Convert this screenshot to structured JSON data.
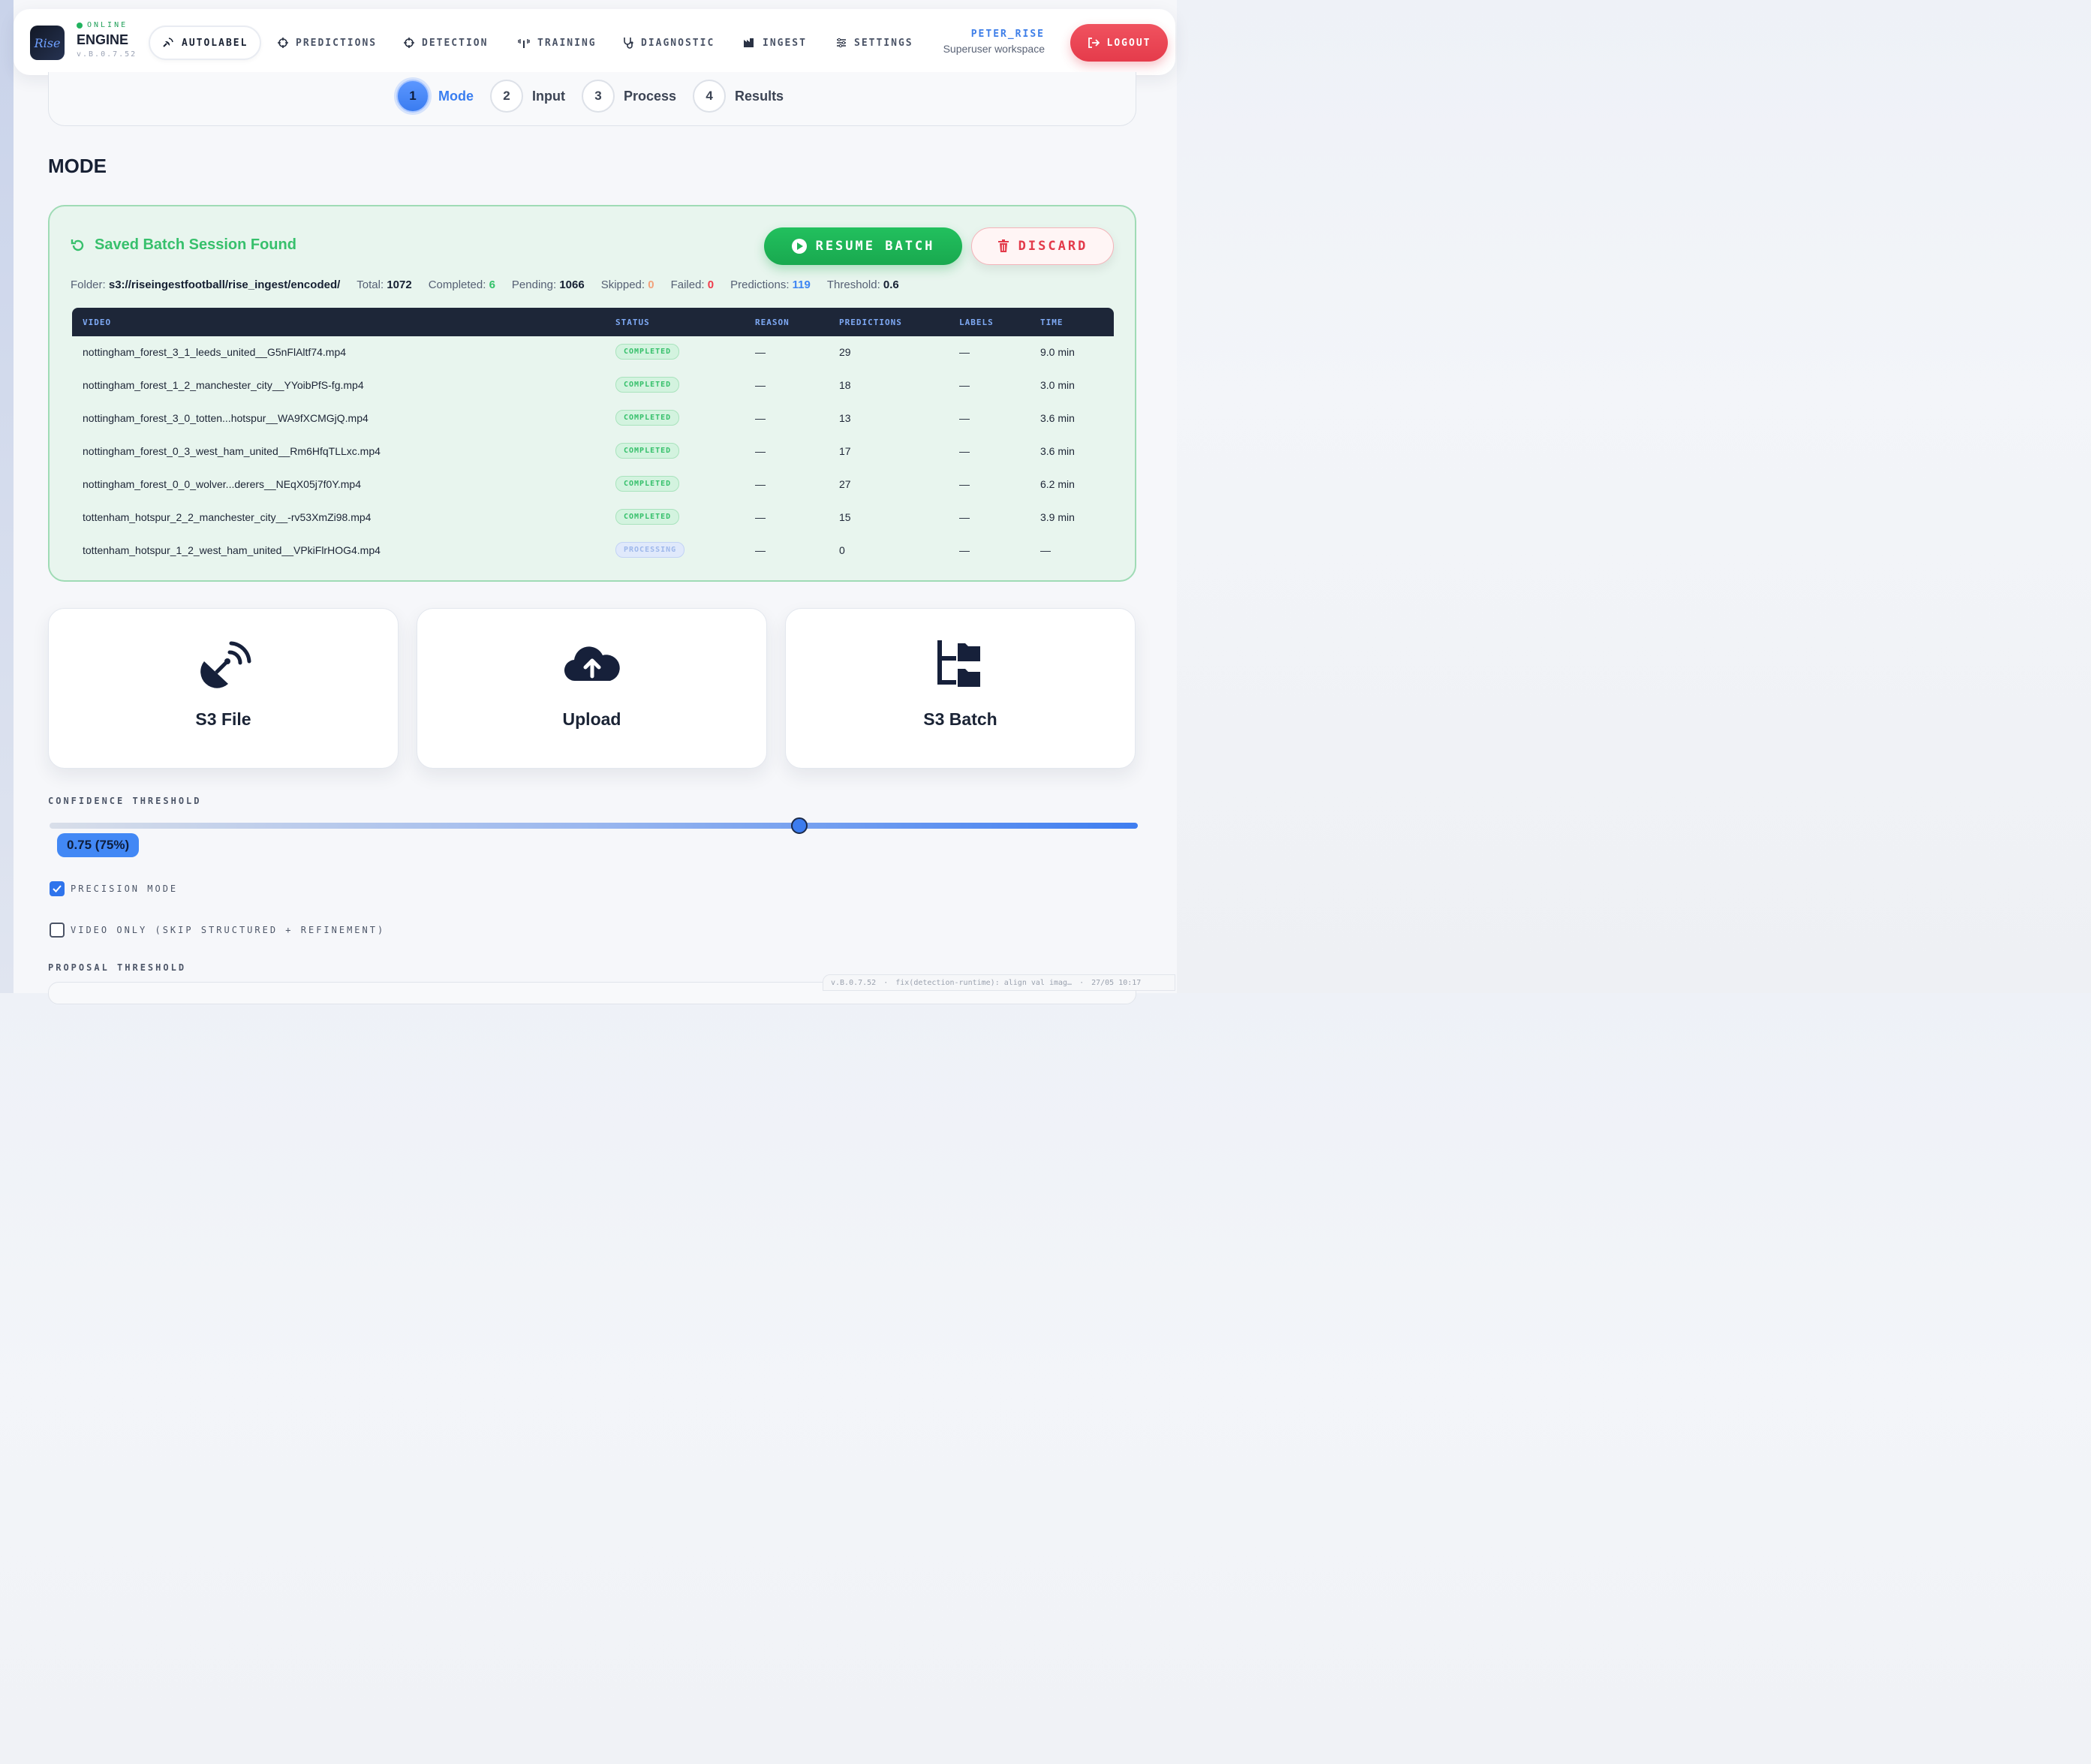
{
  "brand": {
    "status": "ONLINE",
    "name": "ENGINE",
    "version": "v.B.0.7.52",
    "logo_text": "Rise"
  },
  "nav": [
    {
      "label": "AUTOLABEL",
      "icon": "satellite-icon",
      "active": true
    },
    {
      "label": "PREDICTIONS",
      "icon": "crosshair-icon"
    },
    {
      "label": "DETECTION",
      "icon": "crosshair-icon"
    },
    {
      "label": "TRAINING",
      "icon": "antenna-icon"
    },
    {
      "label": "DIAGNOSTIC",
      "icon": "stethoscope-icon"
    },
    {
      "label": "INGEST",
      "icon": "factory-icon"
    },
    {
      "label": "SETTINGS",
      "icon": "sliders-icon"
    }
  ],
  "user": {
    "name": "PETER_RISE",
    "workspace": "Superuser workspace"
  },
  "logout_label": "LOGOUT",
  "stepper": [
    {
      "num": "1",
      "label": "Mode",
      "active": true
    },
    {
      "num": "2",
      "label": "Input"
    },
    {
      "num": "3",
      "label": "Process"
    },
    {
      "num": "4",
      "label": "Results"
    }
  ],
  "mode_title": "MODE",
  "batch": {
    "title": "Saved Batch Session Found",
    "resume_label": "RESUME BATCH",
    "discard_label": "DISCARD",
    "stats": {
      "folder_label": "Folder:",
      "folder": "s3://riseingestfootball/rise_ingest/encoded/",
      "total_label": "Total:",
      "total": "1072",
      "completed_label": "Completed:",
      "completed": "6",
      "pending_label": "Pending:",
      "pending": "1066",
      "skipped_label": "Skipped:",
      "skipped": "0",
      "failed_label": "Failed:",
      "failed": "0",
      "predictions_label": "Predictions:",
      "predictions": "119",
      "threshold_label": "Threshold:",
      "threshold": "0.6"
    },
    "columns": [
      "VIDEO",
      "STATUS",
      "REASON",
      "PREDICTIONS",
      "LABELS",
      "TIME"
    ],
    "rows": [
      {
        "video": "nottingham_forest_3_1_leeds_united__G5nFlAltf74.mp4",
        "status": "COMPLETED",
        "reason": "—",
        "predictions": "29",
        "labels": "—",
        "time": "9.0 min"
      },
      {
        "video": "nottingham_forest_1_2_manchester_city__YYoibPfS-fg.mp4",
        "status": "COMPLETED",
        "reason": "—",
        "predictions": "18",
        "labels": "—",
        "time": "3.0 min"
      },
      {
        "video": "nottingham_forest_3_0_totten...hotspur__WA9fXCMGjQ.mp4",
        "status": "COMPLETED",
        "reason": "—",
        "predictions": "13",
        "labels": "—",
        "time": "3.6 min"
      },
      {
        "video": "nottingham_forest_0_3_west_ham_united__Rm6HfqTLLxc.mp4",
        "status": "COMPLETED",
        "reason": "—",
        "predictions": "17",
        "labels": "—",
        "time": "3.6 min"
      },
      {
        "video": "nottingham_forest_0_0_wolver...derers__NEqX05j7f0Y.mp4",
        "status": "COMPLETED",
        "reason": "—",
        "predictions": "27",
        "labels": "—",
        "time": "6.2 min"
      },
      {
        "video": "tottenham_hotspur_2_2_manchester_city__-rv53XmZi98.mp4",
        "status": "COMPLETED",
        "reason": "—",
        "predictions": "15",
        "labels": "—",
        "time": "3.9 min"
      },
      {
        "video": "tottenham_hotspur_1_2_west_ham_united__VPkiFlrHOG4.mp4",
        "status": "PROCESSING",
        "reason": "—",
        "predictions": "0",
        "labels": "—",
        "time": "—"
      }
    ]
  },
  "modes": [
    {
      "label": "S3 File",
      "icon": "satellite-dish-icon"
    },
    {
      "label": "Upload",
      "icon": "cloud-upload-icon"
    },
    {
      "label": "S3 Batch",
      "icon": "folder-tree-icon"
    }
  ],
  "confidence": {
    "label": "CONFIDENCE THRESHOLD",
    "value_text": "0.75 (75%)",
    "value": 0.75
  },
  "options": {
    "precision_mode": {
      "label": "PRECISION MODE",
      "checked": true
    },
    "video_only": {
      "label": "VIDEO ONLY (SKIP STRUCTURED + REFINEMENT)",
      "checked": false
    }
  },
  "proposal_label": "PROPOSAL THRESHOLD",
  "footer": {
    "version": "v.B.0.7.52",
    "sep": "·",
    "commit": "fix(detection-runtime): align val imag…",
    "date": "27/05 10:17"
  },
  "colors": {
    "accent": "#3d7ee8",
    "success": "#22b35f",
    "danger": "#e53b4b",
    "table_header": "#1d2638"
  }
}
